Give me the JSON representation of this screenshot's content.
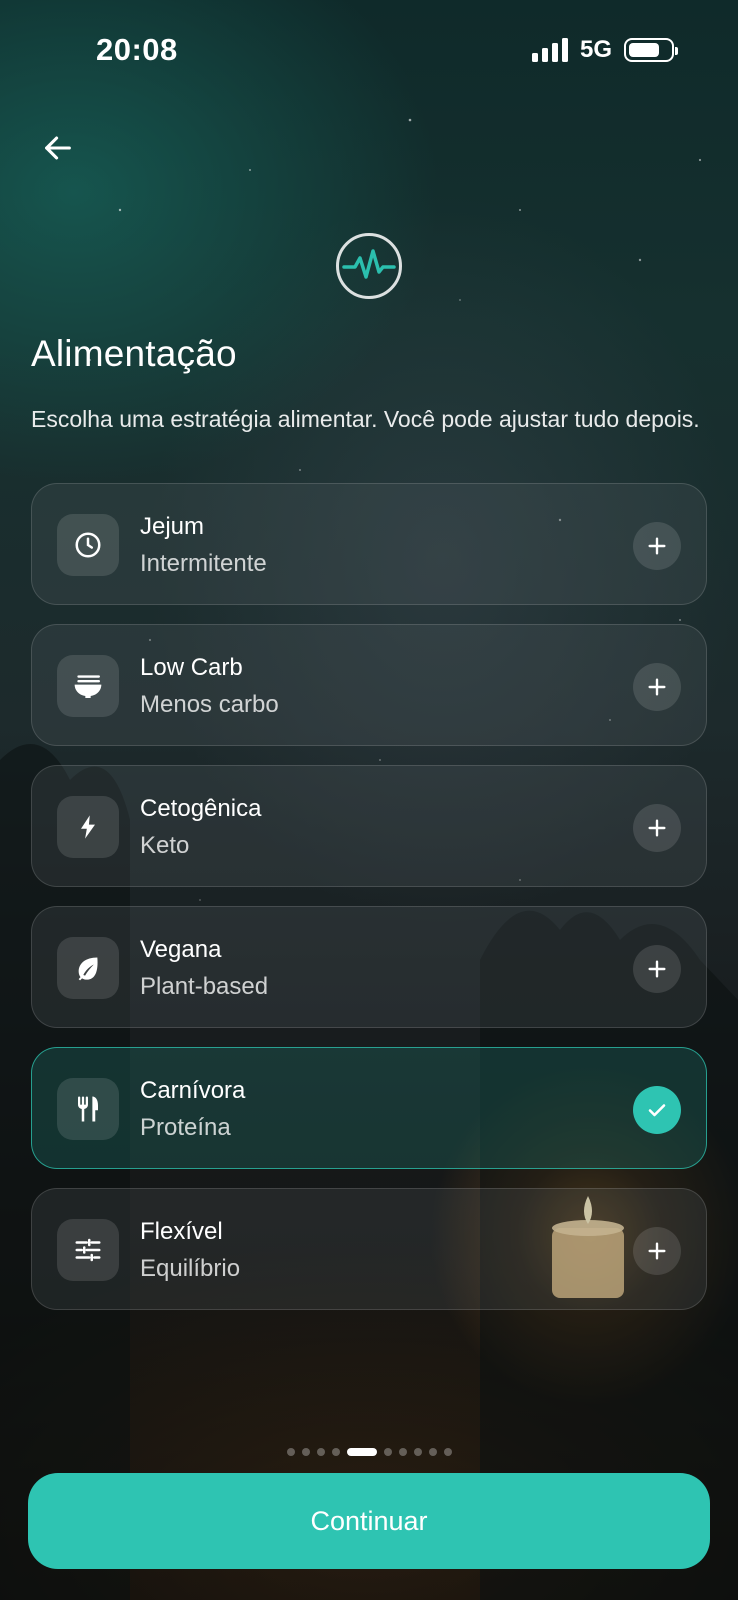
{
  "status_bar": {
    "time": "20:08",
    "network": "5G",
    "battery_level": 0.74
  },
  "header": {
    "back_icon": "arrow-left-icon",
    "logo_icon": "heartbeat-pulse-icon"
  },
  "page": {
    "title": "Alimentação",
    "subtitle": "Escolha uma estratégia alimentar. Você pode ajustar tudo depois."
  },
  "options": [
    {
      "title": "Jejum",
      "subtitle": "Intermitente",
      "icon": "clock-icon",
      "selected": false
    },
    {
      "title": "Low Carb",
      "subtitle": "Menos carbo",
      "icon": "noodle-bowl-icon",
      "selected": false
    },
    {
      "title": "Cetogênica",
      "subtitle": "Keto",
      "icon": "lightning-icon",
      "selected": false
    },
    {
      "title": "Vegana",
      "subtitle": "Plant-based",
      "icon": "leaf-icon",
      "selected": false
    },
    {
      "title": "Carnívora",
      "subtitle": "Proteína",
      "icon": "fork-knife-icon",
      "selected": true
    },
    {
      "title": "Flexível",
      "subtitle": "Equilíbrio",
      "icon": "sliders-icon",
      "selected": false
    }
  ],
  "pagination": {
    "total": 10,
    "active_index": 4
  },
  "continue_label": "Continuar",
  "colors": {
    "accent": "#2ec4b2",
    "logo_teal": "#2bbfae"
  }
}
